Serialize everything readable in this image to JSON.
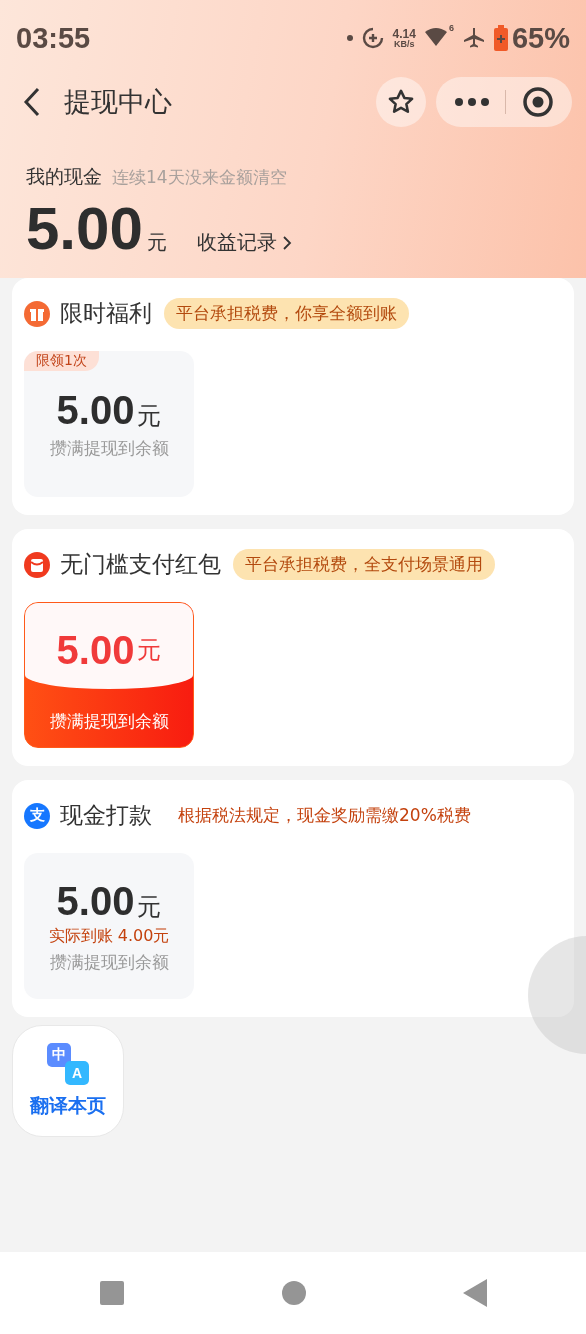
{
  "status_bar": {
    "time": "03:55",
    "speed_value": "4.14",
    "speed_unit": "KB/s",
    "signal_badge": "6",
    "battery": "65%"
  },
  "nav": {
    "title": "提现中心"
  },
  "balance": {
    "label": "我的现金",
    "hint": "连续14天没来金额清空",
    "amount": "5.00",
    "unit": "元",
    "link": "收益记录"
  },
  "sections": [
    {
      "kind": "gift",
      "title": "限时福利",
      "tag": "平台承担税费，你享全额到账",
      "offers": [
        {
          "kind": "plain",
          "badge": "限领1次",
          "amount": "5.00",
          "unit": "元",
          "caption": "攒满提现到余额"
        }
      ]
    },
    {
      "kind": "packet",
      "title": "无门槛支付红包",
      "tag": "平台承担税费，全支付场景通用",
      "offers": [
        {
          "kind": "red",
          "amount": "5.00",
          "unit": "元",
          "caption": "攒满提现到余额"
        }
      ]
    },
    {
      "kind": "pay",
      "icon_text": "支",
      "title": "现金打款",
      "note": "根据税法规定，现金奖励需缴20%税费",
      "offers": [
        {
          "kind": "plain",
          "amount": "5.00",
          "unit": "元",
          "net": "实际到账 4.00元",
          "caption": "攒满提现到余额"
        }
      ]
    }
  ],
  "translate": {
    "icon_zh": "中",
    "icon_en": "A",
    "label": "翻译本页"
  }
}
